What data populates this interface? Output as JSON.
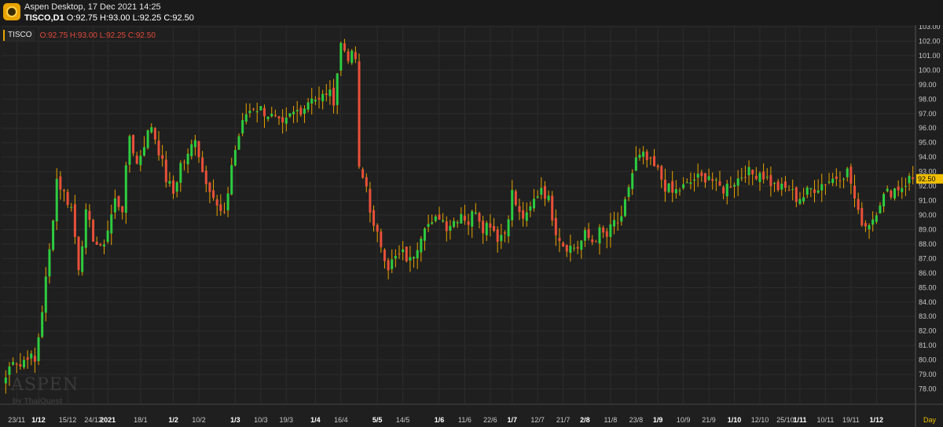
{
  "window": {
    "title": "Aspen Desktop, 17 Dec 2021 14:25",
    "symbol_line": "TISCO,D1",
    "ohlc_text": "O:92.75 H:93.00 L:92.25 C:92.50"
  },
  "legend": {
    "symbol": "TISCO",
    "ohlc": "O:92.75  H:93.00  L:92.25  C:92.50"
  },
  "watermark": {
    "brand": "ASPEN",
    "sub": "by ThaiQuest"
  },
  "colors": {
    "up": "#2ecc40",
    "down": "#e8503a",
    "wick": "#e8a300",
    "grid": "#2c2c2c",
    "text": "#c8c8c8",
    "price_tag": "#f0c000"
  },
  "chart_data": {
    "type": "candlestick",
    "title": "",
    "timeframe_label": "Day",
    "ylim": [
      77,
      103
    ],
    "yticks": [
      "78.00",
      "79.00",
      "80.00",
      "81.00",
      "82.00",
      "83.00",
      "84.00",
      "85.00",
      "86.00",
      "87.00",
      "88.00",
      "89.00",
      "90.00",
      "91.00",
      "92.00",
      "93.00",
      "94.00",
      "95.00",
      "96.00",
      "97.00",
      "98.00",
      "99.00",
      "100.00",
      "101.00",
      "102.00",
      "103.00"
    ],
    "last_price": "92.50",
    "xticks": [
      {
        "label": "23/11",
        "i": 3
      },
      {
        "label": "1/12",
        "i": 9,
        "bold": true
      },
      {
        "label": "15/12",
        "i": 17
      },
      {
        "label": "24/12",
        "i": 24
      },
      {
        "label": "2021",
        "i": 28,
        "bold": true
      },
      {
        "label": "18/1",
        "i": 37
      },
      {
        "label": "1/2",
        "i": 46,
        "bold": true
      },
      {
        "label": "10/2",
        "i": 53
      },
      {
        "label": "1/3",
        "i": 63,
        "bold": true
      },
      {
        "label": "10/3",
        "i": 70
      },
      {
        "label": "19/3",
        "i": 77
      },
      {
        "label": "1/4",
        "i": 85,
        "bold": true
      },
      {
        "label": "16/4",
        "i": 92
      },
      {
        "label": "5/5",
        "i": 102,
        "bold": true
      },
      {
        "label": "14/5",
        "i": 109
      },
      {
        "label": "1/6",
        "i": 119,
        "bold": true
      },
      {
        "label": "11/6",
        "i": 126
      },
      {
        "label": "22/6",
        "i": 133
      },
      {
        "label": "1/7",
        "i": 139,
        "bold": true
      },
      {
        "label": "12/7",
        "i": 146
      },
      {
        "label": "21/7",
        "i": 153
      },
      {
        "label": "2/8",
        "i": 159,
        "bold": true
      },
      {
        "label": "11/8",
        "i": 166
      },
      {
        "label": "23/8",
        "i": 173
      },
      {
        "label": "1/9",
        "i": 179,
        "bold": true
      },
      {
        "label": "10/9",
        "i": 186
      },
      {
        "label": "21/9",
        "i": 193
      },
      {
        "label": "1/10",
        "i": 200,
        "bold": true
      },
      {
        "label": "12/10",
        "i": 207
      },
      {
        "label": "25/10",
        "i": 214
      },
      {
        "label": "1/11",
        "i": 218,
        "bold": true
      },
      {
        "label": "10/11",
        "i": 225
      },
      {
        "label": "19/11",
        "i": 232
      },
      {
        "label": "1/12",
        "i": 239,
        "bold": true
      }
    ],
    "anchors": [
      [
        0,
        78.8
      ],
      [
        2,
        80.2
      ],
      [
        4,
        79.6
      ],
      [
        6,
        80.4
      ],
      [
        8,
        79.8
      ],
      [
        10,
        83.5
      ],
      [
        12,
        87.5
      ],
      [
        14,
        92.5
      ],
      [
        16,
        91.5
      ],
      [
        18,
        90.5
      ],
      [
        20,
        86.5
      ],
      [
        22,
        90.0
      ],
      [
        24,
        88.5
      ],
      [
        26,
        87.5
      ],
      [
        28,
        89.0
      ],
      [
        30,
        91.0
      ],
      [
        32,
        90.5
      ],
      [
        34,
        95.5
      ],
      [
        36,
        93.5
      ],
      [
        38,
        95.0
      ],
      [
        40,
        96.2
      ],
      [
        42,
        94.5
      ],
      [
        44,
        92.5
      ],
      [
        46,
        91.5
      ],
      [
        48,
        93.5
      ],
      [
        50,
        94.0
      ],
      [
        52,
        95.5
      ],
      [
        54,
        93.0
      ],
      [
        56,
        92.0
      ],
      [
        58,
        90.5
      ],
      [
        60,
        89.8
      ],
      [
        62,
        93.5
      ],
      [
        64,
        95.5
      ],
      [
        66,
        97.0
      ],
      [
        68,
        97.5
      ],
      [
        70,
        97.3
      ],
      [
        72,
        97.0
      ],
      [
        74,
        96.5
      ],
      [
        76,
        96.0
      ],
      [
        78,
        96.8
      ],
      [
        80,
        97.2
      ],
      [
        82,
        97.5
      ],
      [
        84,
        98.3
      ],
      [
        86,
        97.8
      ],
      [
        88,
        98.5
      ],
      [
        90,
        98.0
      ],
      [
        92,
        101.8
      ],
      [
        94,
        101.0
      ],
      [
        96,
        100.8
      ],
      [
        97,
        93.0
      ],
      [
        99,
        92.0
      ],
      [
        101,
        89.0
      ],
      [
        103,
        88.0
      ],
      [
        105,
        86.5
      ],
      [
        107,
        87.0
      ],
      [
        109,
        87.3
      ],
      [
        111,
        86.8
      ],
      [
        113,
        88.0
      ],
      [
        115,
        89.5
      ],
      [
        117,
        89.2
      ],
      [
        119,
        90.0
      ],
      [
        121,
        89.3
      ],
      [
        123,
        89.6
      ],
      [
        125,
        90.2
      ],
      [
        127,
        89.5
      ],
      [
        129,
        90.5
      ],
      [
        131,
        89.2
      ],
      [
        133,
        89.5
      ],
      [
        135,
        88.5
      ],
      [
        137,
        88.8
      ],
      [
        139,
        91.5
      ],
      [
        141,
        90.0
      ],
      [
        143,
        89.8
      ],
      [
        145,
        91.0
      ],
      [
        147,
        92.0
      ],
      [
        149,
        91.0
      ],
      [
        151,
        89.0
      ],
      [
        153,
        88.0
      ],
      [
        155,
        87.8
      ],
      [
        157,
        87.8
      ],
      [
        159,
        88.6
      ],
      [
        161,
        88.2
      ],
      [
        163,
        88.8
      ],
      [
        165,
        88.5
      ],
      [
        167,
        89.5
      ],
      [
        169,
        89.5
      ],
      [
        171,
        92.0
      ],
      [
        173,
        93.8
      ],
      [
        175,
        94.0
      ],
      [
        177,
        93.5
      ],
      [
        179,
        93.0
      ],
      [
        181,
        92.0
      ],
      [
        183,
        91.5
      ],
      [
        185,
        91.8
      ],
      [
        187,
        92.0
      ],
      [
        189,
        92.5
      ],
      [
        191,
        92.5
      ],
      [
        193,
        92.8
      ],
      [
        195,
        92.0
      ],
      [
        197,
        91.8
      ],
      [
        199,
        92.2
      ],
      [
        201,
        92.5
      ],
      [
        203,
        93.0
      ],
      [
        205,
        92.8
      ],
      [
        207,
        93.0
      ],
      [
        209,
        92.5
      ],
      [
        211,
        92.0
      ],
      [
        213,
        91.8
      ],
      [
        215,
        91.8
      ],
      [
        217,
        91.2
      ],
      [
        219,
        91.3
      ],
      [
        221,
        91.8
      ],
      [
        223,
        92.0
      ],
      [
        225,
        92.3
      ],
      [
        227,
        92.5
      ],
      [
        229,
        92.8
      ],
      [
        231,
        93.0
      ],
      [
        232,
        92.2
      ],
      [
        234,
        90.0
      ],
      [
        236,
        89.3
      ],
      [
        238,
        89.8
      ],
      [
        240,
        91.0
      ],
      [
        242,
        91.5
      ],
      [
        244,
        91.8
      ],
      [
        246,
        92.0
      ],
      [
        248,
        92.5
      ]
    ]
  }
}
